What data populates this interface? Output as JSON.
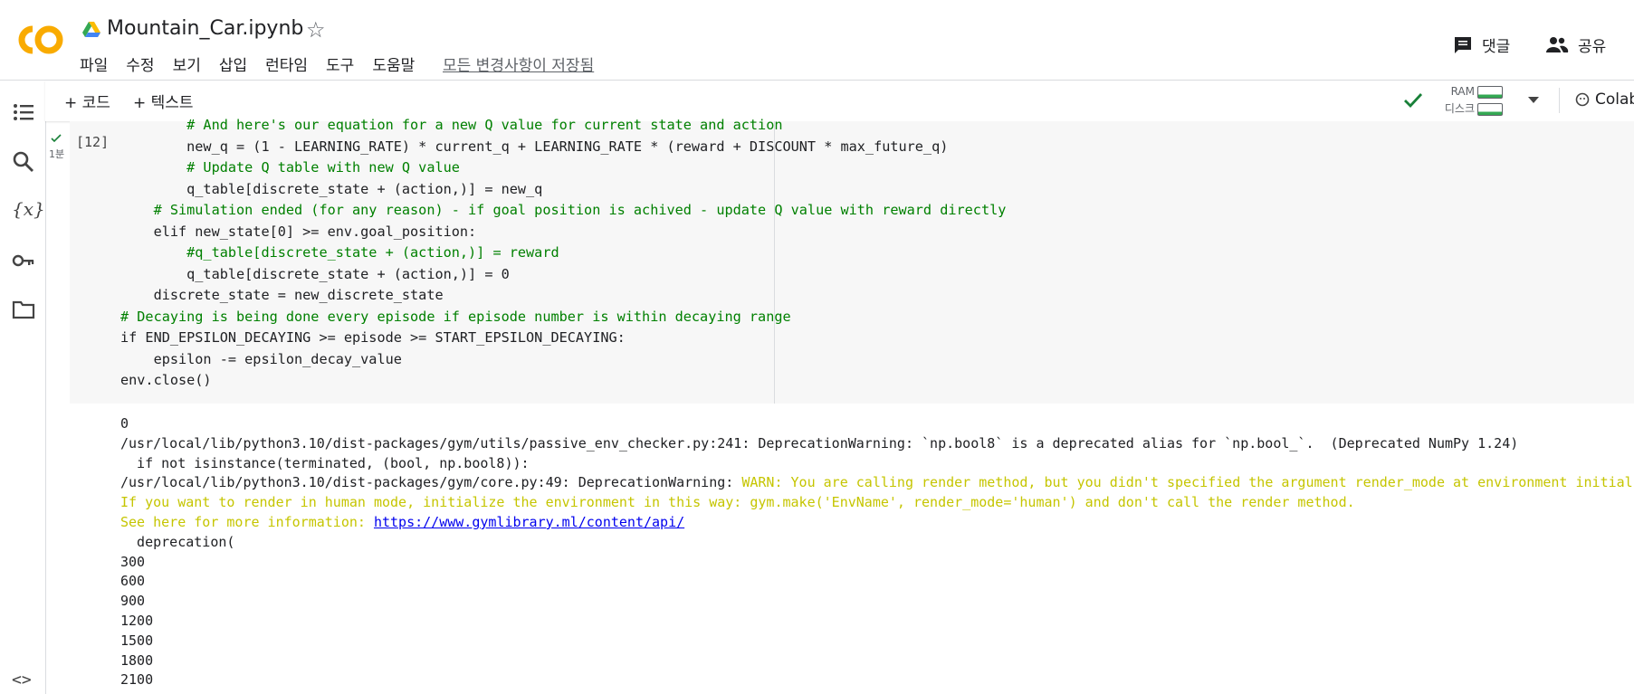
{
  "header": {
    "title": "Mountain_Car.ipynb",
    "menu": [
      "파일",
      "수정",
      "보기",
      "삽입",
      "런타임",
      "도구",
      "도움말"
    ],
    "saved_status": "모든 변경사항이 저장됨",
    "comment_label": "댓글",
    "share_label": "공유"
  },
  "toolbar": {
    "add_code": "+ 코드",
    "add_text": "+ 텍스트",
    "ram_label": "RAM",
    "disk_label": "디스크",
    "colab_label": "Colab"
  },
  "cell": {
    "exec_time": "1분",
    "exec_count": "[12]"
  },
  "code_lines": [
    "        # And here's our equation for a new Q value for current state and action",
    "        new_q = (1 - LEARNING_RATE) * current_q + LEARNING_RATE * (reward + DISCOUNT * max_future_q)",
    "        # Update Q table with new Q value",
    "        q_table[discrete_state + (action,)] = new_q",
    "    # Simulation ended (for any reason) - if goal position is achived - update Q value with reward directly",
    "    elif new_state[0] >= env.goal_position:",
    "        #q_table[discrete_state + (action,)] = reward",
    "        q_table[discrete_state + (action,)] = 0",
    "    discrete_state = new_discrete_state",
    "# Decaying is being done every episode if episode number is within decaying range",
    "if END_EPSILON_DECAYING >= episode >= START_EPSILON_DECAYING:",
    "    epsilon -= epsilon_decay_value",
    "env.close()"
  ],
  "output": {
    "line0": "0",
    "line1": "/usr/local/lib/python3.10/dist-packages/gym/utils/passive_env_checker.py:241: DeprecationWarning: `np.bool8` is a deprecated alias for `np.bool_`.  (Deprecated NumPy 1.24)",
    "line2": "  if not isinstance(terminated, (bool, np.bool8)):",
    "line3a": "/usr/local/lib/python3.10/dist-packages/gym/core.py:49: DeprecationWarning: ",
    "line3b": "WARN: You are calling render method, but you didn't specified the argument render_mode at environment initiali",
    "line4": "If you want to render in human mode, initialize the environment in this way: gym.make('EnvName', render_mode='human') and don't call the render method.",
    "line5a": "See here for more information: ",
    "line5link": "https://www.gymlibrary.ml/content/api/",
    "line6": "  deprecation(",
    "numbers": [
      "300",
      "600",
      "900",
      "1200",
      "1500",
      "1800",
      "2100"
    ]
  },
  "colors": {
    "accent": "#f9ab00",
    "run_check": "#188038",
    "warning_text": "#c5c500"
  }
}
